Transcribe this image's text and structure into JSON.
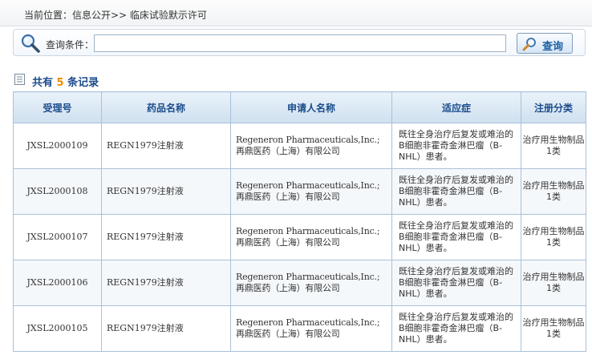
{
  "breadcrumb": "当前位置：信息公开>> 临床试验默示许可",
  "search": {
    "label": "查询条件：",
    "value": "",
    "placeholder": "",
    "button_label": "查询"
  },
  "summary": {
    "prefix": "共有",
    "count": "5",
    "suffix": "条记录"
  },
  "table": {
    "headers": [
      "受理号",
      "药品名称",
      "申请人名称",
      "适应症",
      "注册分类"
    ],
    "rows": [
      {
        "id": "JXSL2000109",
        "drug": "REGN1979注射液",
        "applicant_en": "Regeneron Pharmaceuticals,Inc.;",
        "applicant_cn": "再鼎医药（上海）有限公司",
        "indication": "既往全身治疗后复发或难治的B细胞非霍奇金淋巴瘤（B-NHL）患者。",
        "category": "治疗用生物制品1类"
      },
      {
        "id": "JXSL2000108",
        "drug": "REGN1979注射液",
        "applicant_en": "Regeneron Pharmaceuticals,Inc.;",
        "applicant_cn": "再鼎医药（上海）有限公司",
        "indication": "既往全身治疗后复发或难治的B细胞非霍奇金淋巴瘤（B-NHL）患者。",
        "category": "治疗用生物制品1类"
      },
      {
        "id": "JXSL2000107",
        "drug": "REGN1979注射液",
        "applicant_en": "Regeneron Pharmaceuticals,Inc.;",
        "applicant_cn": "再鼎医药（上海）有限公司",
        "indication": "既往全身治疗后复发或难治的B细胞非霍奇金淋巴瘤（B-NHL）患者。",
        "category": "治疗用生物制品1类"
      },
      {
        "id": "JXSL2000106",
        "drug": "REGN1979注射液",
        "applicant_en": "Regeneron Pharmaceuticals,Inc.;",
        "applicant_cn": "再鼎医药（上海）有限公司",
        "indication": "既往全身治疗后复发或难治的B细胞非霍奇金淋巴瘤（B-NHL）患者。",
        "category": "治疗用生物制品1类"
      },
      {
        "id": "JXSL2000105",
        "drug": "REGN1979注射液",
        "applicant_en": "Regeneron Pharmaceuticals,Inc.;",
        "applicant_cn": "再鼎医药（上海）有限公司",
        "indication": "既往全身治疗后复发或难治的B细胞非霍奇金淋巴瘤（B-NHL）患者。",
        "category": "治疗用生物制品1类"
      }
    ]
  },
  "icons": {
    "search": "magnifier-icon",
    "list": "document-list-icon"
  },
  "colors": {
    "header_text": "#1a4c8c",
    "count_highlight": "#f08a00",
    "table_border": "#a9c1d9"
  }
}
